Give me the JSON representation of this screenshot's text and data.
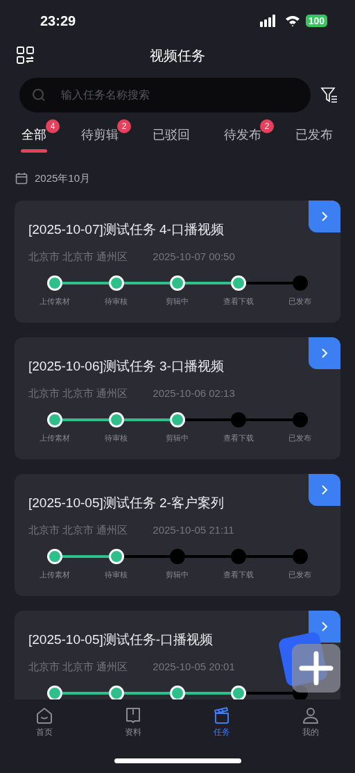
{
  "status_bar": {
    "time": "23:29",
    "battery": "100"
  },
  "header": {
    "title": "视频任务"
  },
  "search": {
    "placeholder": "输入任务名称搜索"
  },
  "tabs": [
    {
      "label": "全部",
      "badge": "4",
      "selected": true
    },
    {
      "label": "待剪辑",
      "badge": "2",
      "selected": false
    },
    {
      "label": "已驳回",
      "selected": false
    },
    {
      "label": "待发布",
      "badge": "2",
      "selected": false
    },
    {
      "label": "已发布",
      "selected": false
    }
  ],
  "month": "2025年10月",
  "tasks": [
    {
      "title": "[2025-10-07]测试任务 4-口播视频",
      "location": "北京市 北京市 通州区",
      "time": "2025-10-07 00:50",
      "steps": [
        {
          "label": "上传素材",
          "done": true
        },
        {
          "label": "待审核",
          "done": true
        },
        {
          "label": "剪辑中",
          "done": true
        },
        {
          "label": "查看下载",
          "done": true
        },
        {
          "label": "已发布",
          "done": false
        }
      ]
    },
    {
      "title": "[2025-10-06]测试任务 3-口播视频",
      "location": "北京市 北京市 通州区",
      "time": "2025-10-06 02:13",
      "steps": [
        {
          "label": "上传素材",
          "done": true
        },
        {
          "label": "待审核",
          "done": true
        },
        {
          "label": "剪辑中",
          "done": true
        },
        {
          "label": "查看下载",
          "done": false
        },
        {
          "label": "已发布",
          "done": false
        }
      ]
    },
    {
      "title": "[2025-10-05]测试任务 2-客户案列",
      "location": "北京市 北京市 通州区",
      "time": "2025-10-05 21:11",
      "steps": [
        {
          "label": "上传素材",
          "done": true
        },
        {
          "label": "待审核",
          "done": true
        },
        {
          "label": "剪辑中",
          "done": false
        },
        {
          "label": "查看下载",
          "done": false
        },
        {
          "label": "已发布",
          "done": false
        }
      ]
    },
    {
      "title": "[2025-10-05]测试任务-口播视频",
      "location": "北京市 北京市 通州区",
      "time": "2025-10-05 20:01",
      "steps": [
        {
          "done": true
        },
        {
          "done": true
        },
        {
          "done": true
        },
        {
          "done": true
        },
        {
          "done": false
        }
      ]
    }
  ],
  "nav": [
    {
      "label": "首页",
      "kind": "home",
      "selected": false
    },
    {
      "label": "资料",
      "kind": "book",
      "selected": false
    },
    {
      "label": "任务",
      "kind": "clapper",
      "selected": true
    },
    {
      "label": "我的",
      "kind": "person",
      "selected": false
    }
  ]
}
